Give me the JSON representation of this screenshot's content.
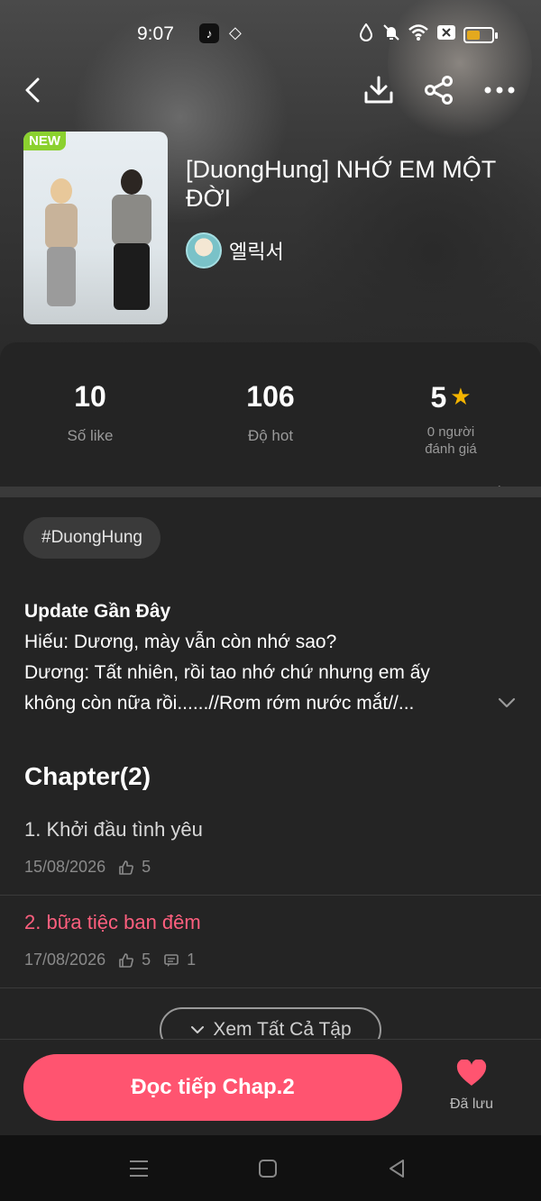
{
  "status_bar": {
    "time": "9:07",
    "tiktok_icon": "tiktok-icon",
    "diamond_icon": "diamond-icon",
    "battery_color": "#e4a91e"
  },
  "header": {
    "back_icon": "back-arrow-icon",
    "download_icon": "download-icon",
    "share_icon": "share-icon",
    "more_icon": "more-icon"
  },
  "book": {
    "badge": "NEW",
    "title": "[DuongHung] NHỚ EM MỘT ĐỜI",
    "author": "엘릭서"
  },
  "stats": {
    "likes_value": "10",
    "likes_label": "Số like",
    "hot_value": "106",
    "hot_label": "Độ hot",
    "rating_value": "5",
    "rating_label_line1": "0 người",
    "rating_label_line2": "đánh giá"
  },
  "tag": "#DuongHung",
  "update": {
    "title": "Update Gần Đây",
    "line1": "Hiếu: Dương, mày vẫn còn nhớ sao?",
    "line2": "Dương: Tất nhiên, rồi tao nhớ chứ nhưng em ấy",
    "line3": "không còn nữa rồi......//Rơm rớm nước mắt//..."
  },
  "chapters": {
    "heading": "Chapter(2)",
    "items": [
      {
        "title": "1. Khởi đầu tình yêu",
        "date": "15/08/2026",
        "likes": "5"
      },
      {
        "title": "2. bữa tiệc ban đêm",
        "date": "17/08/2026",
        "likes": "5",
        "comments": "1"
      }
    ],
    "see_all": "Xem Tất Cả Tập"
  },
  "actions": {
    "read_button": "Đọc tiếp Chap.2",
    "saved_label": "Đã lưu"
  },
  "colors": {
    "accent": "#ff5470",
    "active_chapter": "#ff5f7e",
    "star": "#f4b400",
    "new_badge": "#8bd12f"
  }
}
